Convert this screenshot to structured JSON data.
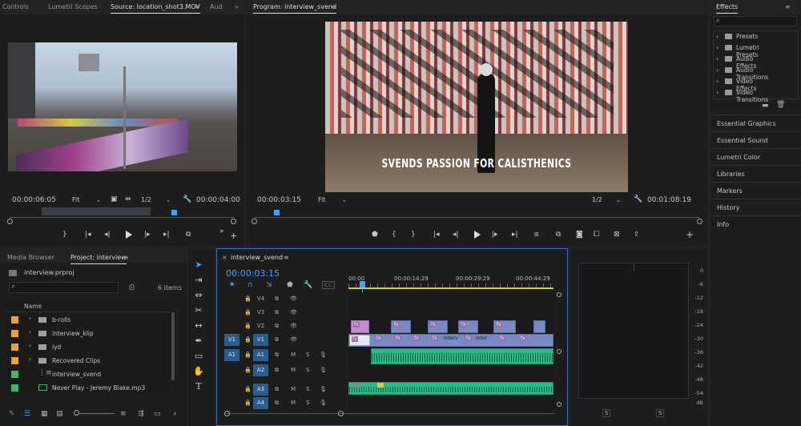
{
  "source_panel": {
    "tabs": [
      "Controls",
      "Lumetri Scopes",
      "Source: location_shot3.MOV",
      "Aud"
    ],
    "timecode_left": "00:00:06:05",
    "fit": "Fit",
    "resolution": "1/2",
    "timecode_right": "00:00:04:00"
  },
  "program_panel": {
    "title": "Program: interview_svend",
    "overlay_text": "SVENDS PASSION FOR CALISTHENICS",
    "timecode_left": "00:00:03:15",
    "fit": "Fit",
    "resolution": "1/2",
    "timecode_right": "00:01:08:19"
  },
  "effects_panel": {
    "title": "Effects",
    "items": [
      "Presets",
      "Lumetri Presets",
      "Audio Effects",
      "Audio Transitions",
      "Video Effects",
      "Video Transitions"
    ],
    "side_panels": [
      "Essential Graphics",
      "Essential Sound",
      "Lumetri Color",
      "Libraries",
      "Markers",
      "History",
      "Info"
    ]
  },
  "project_panel": {
    "tabs": [
      "Media Browser",
      "Project: interview"
    ],
    "project_file": "interview.prproj",
    "item_count": "6 items",
    "column_name": "Name",
    "items": [
      {
        "name": "b-rolls",
        "type": "folder",
        "color": "#e8a040"
      },
      {
        "name": "interview_klip",
        "type": "folder",
        "color": "#e8a040"
      },
      {
        "name": "lyd",
        "type": "folder",
        "color": "#e8a040"
      },
      {
        "name": "Recovered Clips",
        "type": "folder",
        "color": "#e8a040"
      },
      {
        "name": "interview_svend",
        "type": "sequence",
        "color": "#3fb86a"
      },
      {
        "name": "Never Play - Jeremy Blake.mp3",
        "type": "audio",
        "color": "#3fb86a"
      }
    ]
  },
  "timeline": {
    "tab": "interview_svend",
    "timecode": "00:00:03:15",
    "ruler": [
      "00:00",
      "00:00:14:29",
      "00:00:29:29",
      "00:00:44:29"
    ],
    "video_tracks": [
      "V4",
      "V3",
      "V2",
      "V1"
    ],
    "audio_tracks": [
      "A1",
      "A2",
      "A3",
      "A4"
    ],
    "source_patch_video": "V1",
    "source_patch_audio": "A1",
    "clip_labels": [
      "interv",
      "inter"
    ],
    "fx_label": "fx"
  },
  "meter": {
    "scale": [
      "0",
      "-6",
      "-12",
      "-18",
      "-24",
      "-30",
      "-36",
      "-42",
      "-48",
      "-54",
      "dB"
    ],
    "solo": "S"
  }
}
